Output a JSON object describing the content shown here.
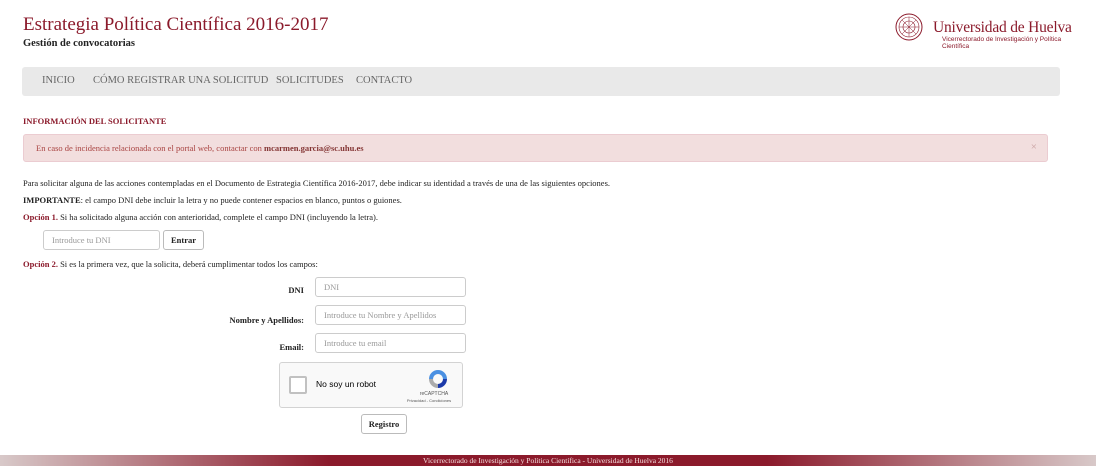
{
  "header": {
    "title": "Estrategia Política Científica 2016-2017",
    "subtitle": "Gestión de convocatorias",
    "logo": {
      "name": "Universidad de Huelva",
      "subtitle": "Vicerrectorado de Investigación y Política Científica"
    }
  },
  "nav": {
    "items": [
      {
        "label": "INICIO"
      },
      {
        "label": "CÓMO REGISTRAR UNA SOLICITUD"
      },
      {
        "label": "SOLICITUDES"
      },
      {
        "label": "CONTACTO"
      }
    ]
  },
  "section": {
    "title": "INFORMACIÓN DEL SOLICITANTE"
  },
  "alert": {
    "text": "En caso de incidencia relacionada con el portal web, contactar con",
    "email": "mcarmen.garcia@sc.uhu.es",
    "close": "×"
  },
  "intro": {
    "text": "Para solicitar alguna de las acciones contempladas en el Documento de Estrategia Científica 2016-2017, debe indicar su identidad a través de una de las siguientes opciones.",
    "important_label": "IMPORTANTE",
    "important_text": ": el campo DNI debe incluir la letra y no puede contener espacios en blanco, puntos o guiones."
  },
  "option1": {
    "label": "Opción 1.",
    "text": "Si ha solicitado alguna acción con anterioridad, complete el campo DNI (incluyendo la letra).",
    "dni_placeholder": "Introduce tu DNI",
    "submit_label": "Entrar"
  },
  "option2": {
    "label": "Opción 2.",
    "text": "Si es la primera vez, que la solicita, deberá cumplimentar todos los campos:",
    "fields": {
      "dni": {
        "label": "DNI",
        "placeholder": "DNI"
      },
      "name": {
        "label": "Nombre y Apellidos:",
        "placeholder": "Introduce tu Nombre y Apellidos"
      },
      "email": {
        "label": "Email:",
        "placeholder": "Introduce tu email"
      }
    },
    "captcha": {
      "label": "No soy un robot",
      "brand": "reCAPTCHA",
      "links": "Privacidad - Condiciones"
    },
    "submit_label": "Registro"
  },
  "footer": {
    "text": "Vicerrectorado de Investigación y Política Científica - Universidad de Huelva 2016"
  },
  "colors": {
    "brand": "#8b1a2b",
    "alert_bg": "#f2dede",
    "navbar_bg": "#e9e9e9"
  }
}
